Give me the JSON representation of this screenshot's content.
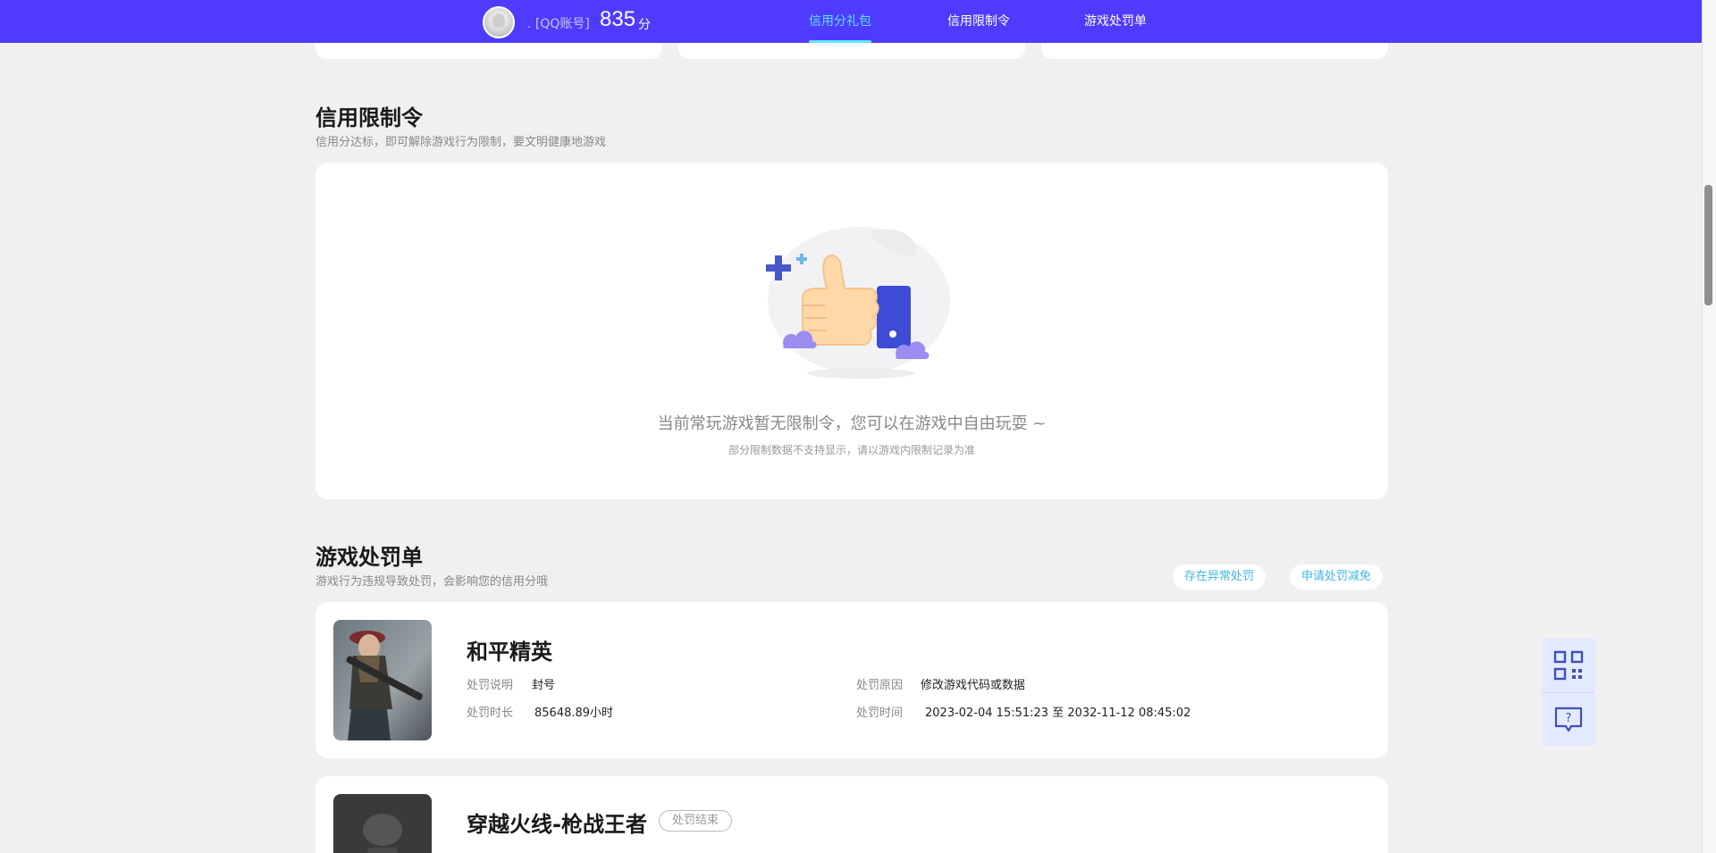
{
  "header": {
    "account_label": ". [QQ账号]",
    "score": "835",
    "score_unit": "分",
    "nav": [
      {
        "label": "信用分礼包",
        "active": true
      },
      {
        "label": "信用限制令",
        "active": false
      },
      {
        "label": "游戏处罚单",
        "active": false
      }
    ]
  },
  "restriction": {
    "title": "信用限制令",
    "subtitle": "信用分达标，即可解除游戏行为限制，要文明健康地游戏",
    "empty_main": "当前常玩游戏暂无限制令，您可以在游戏中自由玩耍 ~",
    "empty_sub": "部分限制数据不支持显示，请以游戏内限制记录为准",
    "illustration_icon": "thumbs-up-icon"
  },
  "punishment": {
    "title": "游戏处罚单",
    "subtitle": "游戏行为违规导致处罚，会影响您的信用分哦",
    "btn_abnormal": "存在异常处罚",
    "btn_reduce": "申请处罚减免",
    "items": [
      {
        "game": "和平精英",
        "tag": "",
        "desc_label": "处罚说明",
        "desc": "封号",
        "reason_label": "处罚原因",
        "reason": "修改游戏代码或数据",
        "duration_label": "处罚时长",
        "duration": "85648.89小时",
        "time_label": "处罚时间",
        "time": "2023-02-04 15:51:23 至 2032-11-12 08:45:02"
      },
      {
        "game": "穿越火线-枪战王者",
        "tag": "处罚结束"
      }
    ]
  },
  "colors": {
    "header_bg": "#4f3bfd",
    "accent": "#5fe3ff",
    "link": "#3db7e6"
  }
}
